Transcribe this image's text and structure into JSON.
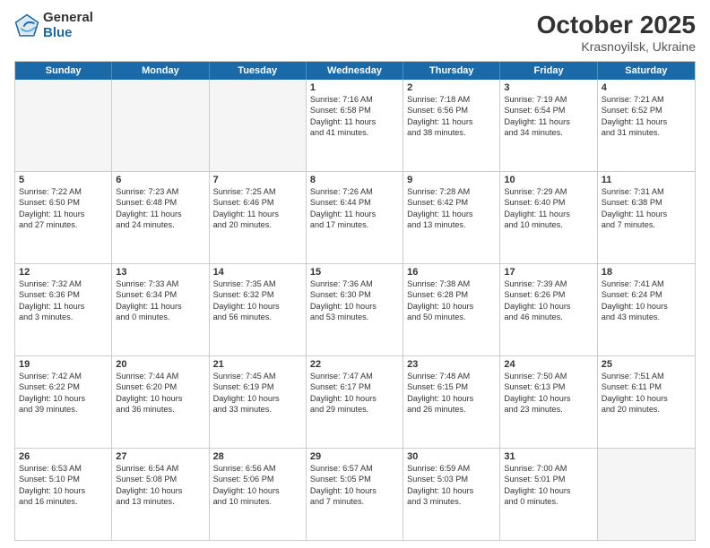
{
  "header": {
    "logo_general": "General",
    "logo_blue": "Blue",
    "month": "October 2025",
    "location": "Krasnoyilsk, Ukraine"
  },
  "days_of_week": [
    "Sunday",
    "Monday",
    "Tuesday",
    "Wednesday",
    "Thursday",
    "Friday",
    "Saturday"
  ],
  "weeks": [
    [
      {
        "day": "",
        "empty": true
      },
      {
        "day": "",
        "empty": true
      },
      {
        "day": "",
        "empty": true
      },
      {
        "day": "1",
        "lines": [
          "Sunrise: 7:16 AM",
          "Sunset: 6:58 PM",
          "Daylight: 11 hours",
          "and 41 minutes."
        ]
      },
      {
        "day": "2",
        "lines": [
          "Sunrise: 7:18 AM",
          "Sunset: 6:56 PM",
          "Daylight: 11 hours",
          "and 38 minutes."
        ]
      },
      {
        "day": "3",
        "lines": [
          "Sunrise: 7:19 AM",
          "Sunset: 6:54 PM",
          "Daylight: 11 hours",
          "and 34 minutes."
        ]
      },
      {
        "day": "4",
        "lines": [
          "Sunrise: 7:21 AM",
          "Sunset: 6:52 PM",
          "Daylight: 11 hours",
          "and 31 minutes."
        ]
      }
    ],
    [
      {
        "day": "5",
        "lines": [
          "Sunrise: 7:22 AM",
          "Sunset: 6:50 PM",
          "Daylight: 11 hours",
          "and 27 minutes."
        ]
      },
      {
        "day": "6",
        "lines": [
          "Sunrise: 7:23 AM",
          "Sunset: 6:48 PM",
          "Daylight: 11 hours",
          "and 24 minutes."
        ]
      },
      {
        "day": "7",
        "lines": [
          "Sunrise: 7:25 AM",
          "Sunset: 6:46 PM",
          "Daylight: 11 hours",
          "and 20 minutes."
        ]
      },
      {
        "day": "8",
        "lines": [
          "Sunrise: 7:26 AM",
          "Sunset: 6:44 PM",
          "Daylight: 11 hours",
          "and 17 minutes."
        ]
      },
      {
        "day": "9",
        "lines": [
          "Sunrise: 7:28 AM",
          "Sunset: 6:42 PM",
          "Daylight: 11 hours",
          "and 13 minutes."
        ]
      },
      {
        "day": "10",
        "lines": [
          "Sunrise: 7:29 AM",
          "Sunset: 6:40 PM",
          "Daylight: 11 hours",
          "and 10 minutes."
        ]
      },
      {
        "day": "11",
        "lines": [
          "Sunrise: 7:31 AM",
          "Sunset: 6:38 PM",
          "Daylight: 11 hours",
          "and 7 minutes."
        ]
      }
    ],
    [
      {
        "day": "12",
        "lines": [
          "Sunrise: 7:32 AM",
          "Sunset: 6:36 PM",
          "Daylight: 11 hours",
          "and 3 minutes."
        ]
      },
      {
        "day": "13",
        "lines": [
          "Sunrise: 7:33 AM",
          "Sunset: 6:34 PM",
          "Daylight: 11 hours",
          "and 0 minutes."
        ]
      },
      {
        "day": "14",
        "lines": [
          "Sunrise: 7:35 AM",
          "Sunset: 6:32 PM",
          "Daylight: 10 hours",
          "and 56 minutes."
        ]
      },
      {
        "day": "15",
        "lines": [
          "Sunrise: 7:36 AM",
          "Sunset: 6:30 PM",
          "Daylight: 10 hours",
          "and 53 minutes."
        ]
      },
      {
        "day": "16",
        "lines": [
          "Sunrise: 7:38 AM",
          "Sunset: 6:28 PM",
          "Daylight: 10 hours",
          "and 50 minutes."
        ]
      },
      {
        "day": "17",
        "lines": [
          "Sunrise: 7:39 AM",
          "Sunset: 6:26 PM",
          "Daylight: 10 hours",
          "and 46 minutes."
        ]
      },
      {
        "day": "18",
        "lines": [
          "Sunrise: 7:41 AM",
          "Sunset: 6:24 PM",
          "Daylight: 10 hours",
          "and 43 minutes."
        ]
      }
    ],
    [
      {
        "day": "19",
        "lines": [
          "Sunrise: 7:42 AM",
          "Sunset: 6:22 PM",
          "Daylight: 10 hours",
          "and 39 minutes."
        ]
      },
      {
        "day": "20",
        "lines": [
          "Sunrise: 7:44 AM",
          "Sunset: 6:20 PM",
          "Daylight: 10 hours",
          "and 36 minutes."
        ]
      },
      {
        "day": "21",
        "lines": [
          "Sunrise: 7:45 AM",
          "Sunset: 6:19 PM",
          "Daylight: 10 hours",
          "and 33 minutes."
        ]
      },
      {
        "day": "22",
        "lines": [
          "Sunrise: 7:47 AM",
          "Sunset: 6:17 PM",
          "Daylight: 10 hours",
          "and 29 minutes."
        ]
      },
      {
        "day": "23",
        "lines": [
          "Sunrise: 7:48 AM",
          "Sunset: 6:15 PM",
          "Daylight: 10 hours",
          "and 26 minutes."
        ]
      },
      {
        "day": "24",
        "lines": [
          "Sunrise: 7:50 AM",
          "Sunset: 6:13 PM",
          "Daylight: 10 hours",
          "and 23 minutes."
        ]
      },
      {
        "day": "25",
        "lines": [
          "Sunrise: 7:51 AM",
          "Sunset: 6:11 PM",
          "Daylight: 10 hours",
          "and 20 minutes."
        ]
      }
    ],
    [
      {
        "day": "26",
        "lines": [
          "Sunrise: 6:53 AM",
          "Sunset: 5:10 PM",
          "Daylight: 10 hours",
          "and 16 minutes."
        ]
      },
      {
        "day": "27",
        "lines": [
          "Sunrise: 6:54 AM",
          "Sunset: 5:08 PM",
          "Daylight: 10 hours",
          "and 13 minutes."
        ]
      },
      {
        "day": "28",
        "lines": [
          "Sunrise: 6:56 AM",
          "Sunset: 5:06 PM",
          "Daylight: 10 hours",
          "and 10 minutes."
        ]
      },
      {
        "day": "29",
        "lines": [
          "Sunrise: 6:57 AM",
          "Sunset: 5:05 PM",
          "Daylight: 10 hours",
          "and 7 minutes."
        ]
      },
      {
        "day": "30",
        "lines": [
          "Sunrise: 6:59 AM",
          "Sunset: 5:03 PM",
          "Daylight: 10 hours",
          "and 3 minutes."
        ]
      },
      {
        "day": "31",
        "lines": [
          "Sunrise: 7:00 AM",
          "Sunset: 5:01 PM",
          "Daylight: 10 hours",
          "and 0 minutes."
        ]
      },
      {
        "day": "",
        "empty": true
      }
    ]
  ]
}
